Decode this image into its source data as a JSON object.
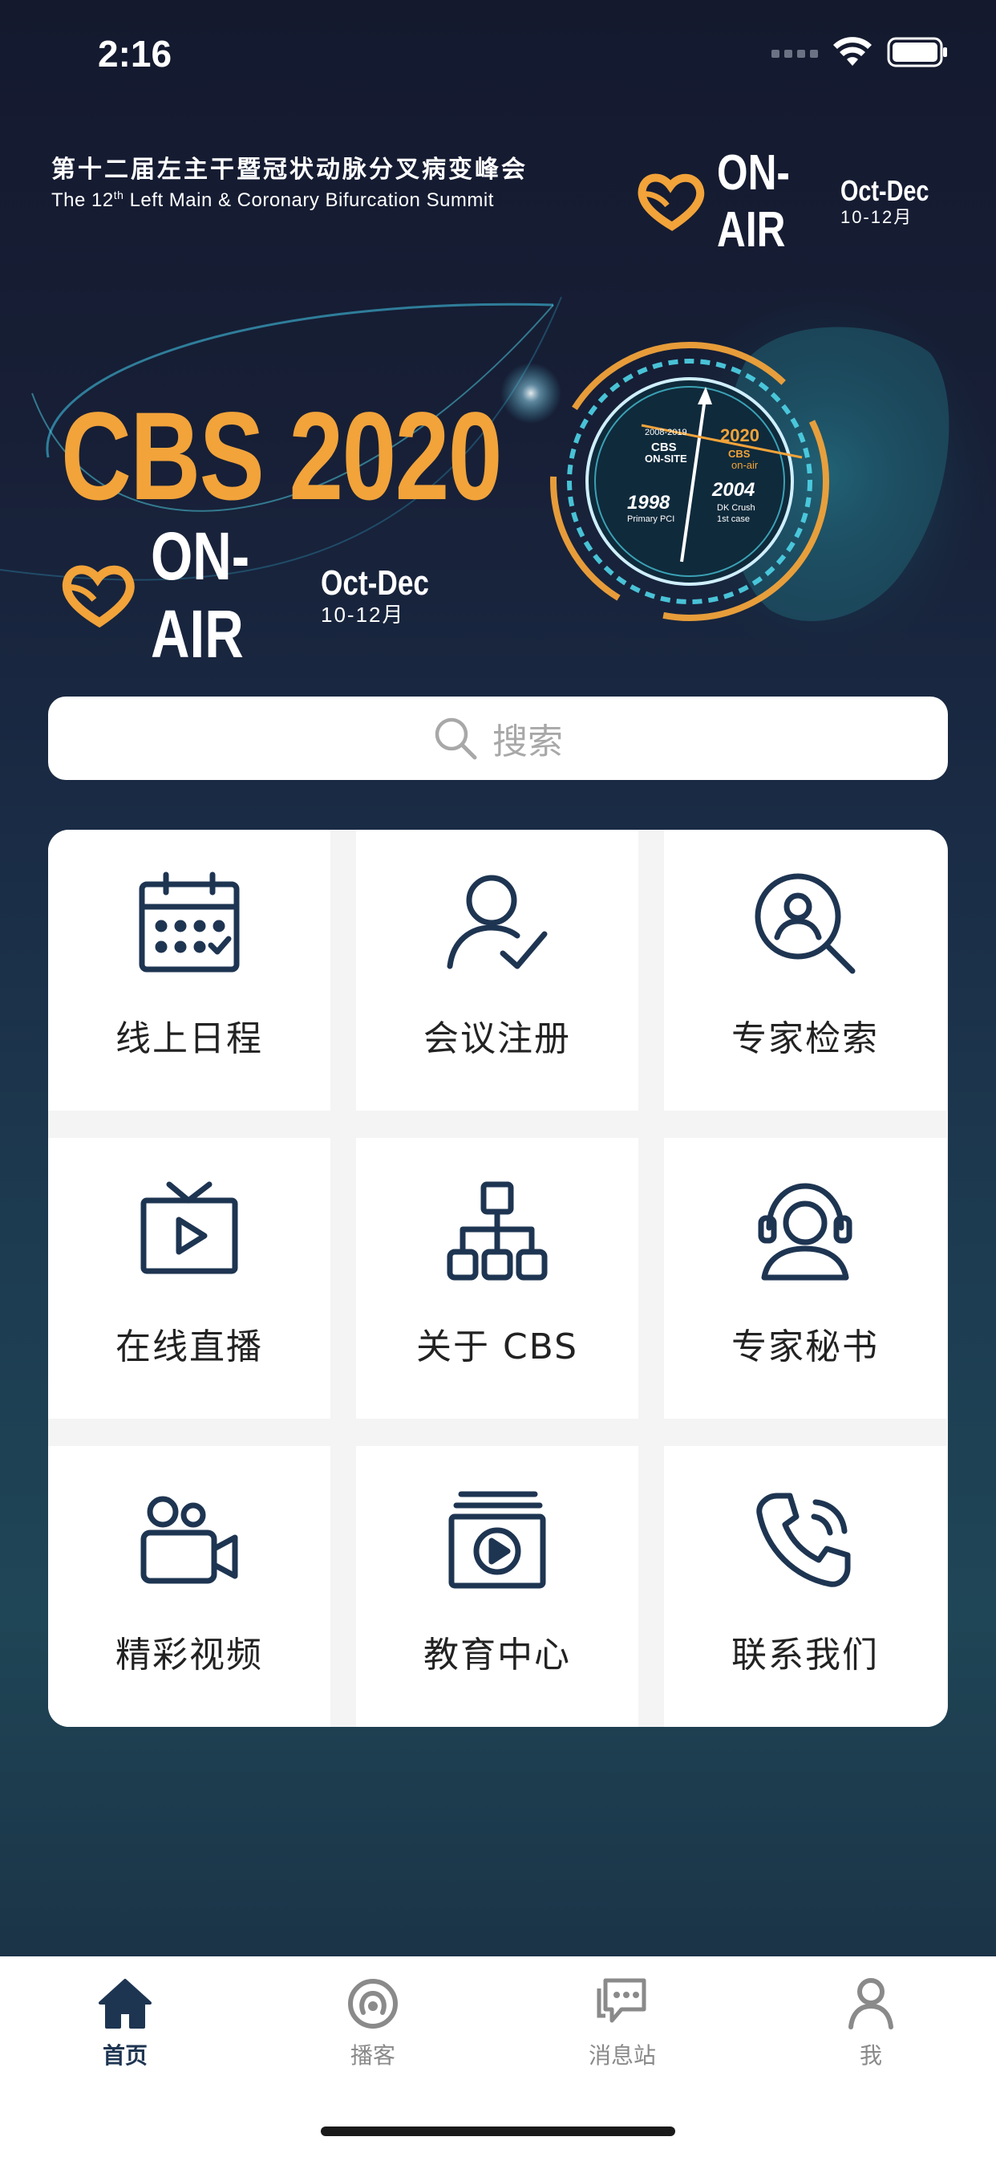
{
  "status_bar": {
    "time": "2:16"
  },
  "header": {
    "summit_cn": "第十二届左主干暨冠状动脉分叉病变峰会",
    "summit_en_prefix": "The 12",
    "summit_en_sup": "th",
    "summit_en_suffix": "Left Main & Coronary Bifurcation Summit",
    "onair_label": "ON-AIR",
    "date_en": "Oct-Dec",
    "date_cn": "10-12月"
  },
  "banner": {
    "title": "CBS 2020",
    "onair_label": "ON-AIR",
    "date_en": "Oct-Dec",
    "date_cn": "10-12月",
    "dial": {
      "label_range": "2008-2019",
      "label_onsite_1": "CBS",
      "label_onsite_2": "ON-SITE",
      "label_2020": "2020",
      "label_onair_1": "CBS",
      "label_onair_2": "on-air",
      "label_1998": "1998",
      "label_1998_sub": "Primary PCI",
      "label_2004": "2004",
      "label_2004_sub1": "DK Crush",
      "label_2004_sub2": "1st case"
    }
  },
  "search": {
    "placeholder": "搜索"
  },
  "menu": [
    {
      "label": "线上日程",
      "icon": "calendar-icon"
    },
    {
      "label": "会议注册",
      "icon": "user-check-icon"
    },
    {
      "label": "专家检索",
      "icon": "expert-search-icon"
    },
    {
      "label": "在线直播",
      "icon": "live-tv-icon"
    },
    {
      "label": "关于 CBS",
      "icon": "org-chart-icon"
    },
    {
      "label": "专家秘书",
      "icon": "headset-user-icon"
    },
    {
      "label": "精彩视频",
      "icon": "video-camera-icon"
    },
    {
      "label": "教育中心",
      "icon": "education-video-icon"
    },
    {
      "label": "联系我们",
      "icon": "phone-call-icon"
    }
  ],
  "tabs": [
    {
      "label": "首页",
      "icon": "home-icon",
      "active": true
    },
    {
      "label": "播客",
      "icon": "podcast-icon",
      "active": false
    },
    {
      "label": "消息站",
      "icon": "message-icon",
      "active": false
    },
    {
      "label": "我",
      "icon": "profile-icon",
      "active": false
    }
  ],
  "colors": {
    "accent_orange": "#f2a33a",
    "icon_navy": "#1e3552",
    "dial_cyan": "#4fd4e8"
  }
}
